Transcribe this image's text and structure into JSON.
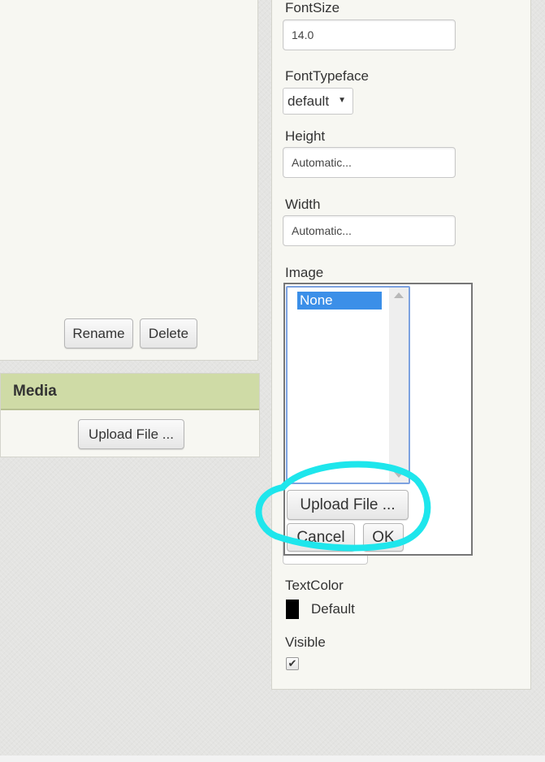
{
  "components": {
    "rename_label": "Rename",
    "delete_label": "Delete"
  },
  "media": {
    "title": "Media",
    "upload_label": "Upload File ..."
  },
  "properties": {
    "font_size": {
      "label": "FontSize",
      "value": "14.0"
    },
    "font_typeface": {
      "label": "FontTypeface",
      "selected": "default"
    },
    "height": {
      "label": "Height",
      "value": "Automatic..."
    },
    "width": {
      "label": "Width",
      "value": "Automatic..."
    },
    "image": {
      "label": "Image",
      "options": [
        "None"
      ],
      "selected": "None",
      "upload_label": "Upload File ...",
      "cancel_label": "Cancel",
      "ok_label": "OK"
    },
    "text_color": {
      "label": "TextColor",
      "value": "Default",
      "swatch_color": "#000000"
    },
    "visible": {
      "label": "Visible",
      "checked": true,
      "check_glyph": "✔"
    }
  },
  "annotation": {
    "color": "#1ee6ec",
    "shape": "hand-drawn ellipse"
  },
  "colors": {
    "panel_bg": "#f7f7f2",
    "media_header_bg": "#cfdba6",
    "selection_blue": "#3b8fe8"
  }
}
